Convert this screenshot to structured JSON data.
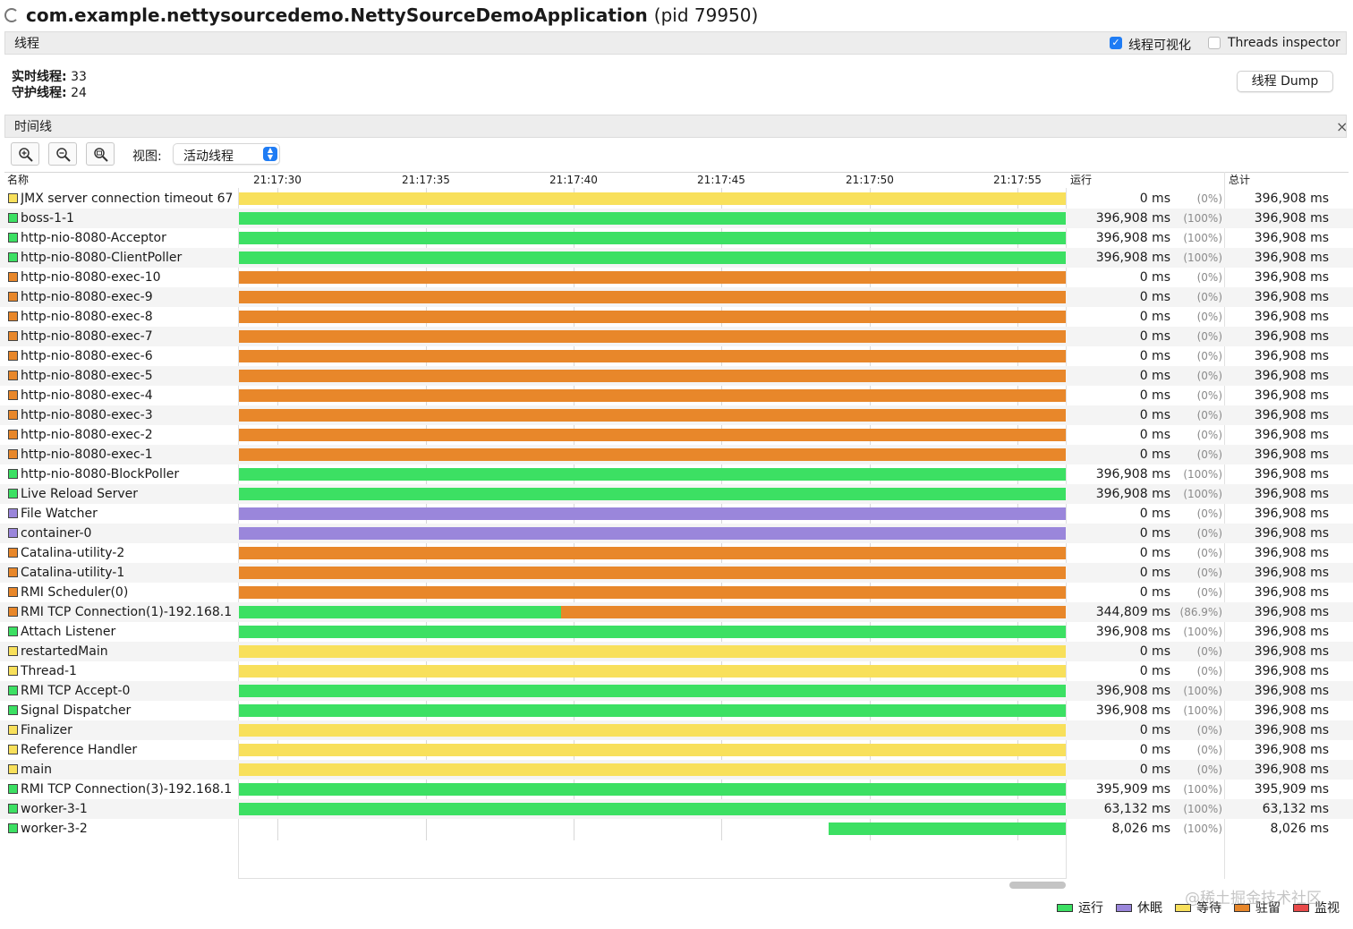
{
  "window": {
    "title": "com.example.nettysourcedemo.NettySourceDemoApplication",
    "pid": "(pid 79950)"
  },
  "threads_section": {
    "title": "线程",
    "viz_checkbox_label": "线程可视化",
    "viz_checked": true,
    "inspector_label": "Threads inspector",
    "inspector_checked": false,
    "live_label": "实时线程:",
    "live_value": "33",
    "daemon_label": "守护线程:",
    "daemon_value": "24",
    "dump_button": "线程 Dump"
  },
  "timeline_section": {
    "title": "时间线",
    "close_glyph": "×",
    "view_label": "视图:",
    "view_value": "活动线程",
    "icons": [
      "zoom-in-icon",
      "zoom-out-icon",
      "zoom-fit-icon",
      "close-icon"
    ]
  },
  "columns": {
    "name": "名称",
    "run": "运行",
    "total": "总计"
  },
  "ticks": [
    "21:17:30",
    "21:17:35",
    "21:17:40",
    "21:17:45",
    "21:17:50",
    "21:17:55"
  ],
  "colors": {
    "running": "#3ce063",
    "sleeping": "#9a86db",
    "waiting": "#f8e05b",
    "parked": "#e8872a",
    "monitor": "#e94a4a"
  },
  "threads": [
    {
      "name": "JMX server connection timeout 67",
      "state": "waiting",
      "run": "0 ms",
      "pct": "(0%)",
      "total": "396,908 ms",
      "segments": [
        {
          "state": "waiting",
          "start": 0,
          "end": 1
        }
      ]
    },
    {
      "name": "boss-1-1",
      "state": "running",
      "run": "396,908 ms",
      "pct": "(100%)",
      "total": "396,908 ms",
      "segments": [
        {
          "state": "running",
          "start": 0,
          "end": 1
        }
      ]
    },
    {
      "name": "http-nio-8080-Acceptor",
      "state": "running",
      "run": "396,908 ms",
      "pct": "(100%)",
      "total": "396,908 ms",
      "segments": [
        {
          "state": "running",
          "start": 0,
          "end": 1
        }
      ]
    },
    {
      "name": "http-nio-8080-ClientPoller",
      "state": "running",
      "run": "396,908 ms",
      "pct": "(100%)",
      "total": "396,908 ms",
      "segments": [
        {
          "state": "running",
          "start": 0,
          "end": 1
        }
      ]
    },
    {
      "name": "http-nio-8080-exec-10",
      "state": "parked",
      "run": "0 ms",
      "pct": "(0%)",
      "total": "396,908 ms",
      "segments": [
        {
          "state": "parked",
          "start": 0,
          "end": 1
        }
      ]
    },
    {
      "name": "http-nio-8080-exec-9",
      "state": "parked",
      "run": "0 ms",
      "pct": "(0%)",
      "total": "396,908 ms",
      "segments": [
        {
          "state": "parked",
          "start": 0,
          "end": 1
        }
      ]
    },
    {
      "name": "http-nio-8080-exec-8",
      "state": "parked",
      "run": "0 ms",
      "pct": "(0%)",
      "total": "396,908 ms",
      "segments": [
        {
          "state": "parked",
          "start": 0,
          "end": 1
        }
      ]
    },
    {
      "name": "http-nio-8080-exec-7",
      "state": "parked",
      "run": "0 ms",
      "pct": "(0%)",
      "total": "396,908 ms",
      "segments": [
        {
          "state": "parked",
          "start": 0,
          "end": 1
        }
      ]
    },
    {
      "name": "http-nio-8080-exec-6",
      "state": "parked",
      "run": "0 ms",
      "pct": "(0%)",
      "total": "396,908 ms",
      "segments": [
        {
          "state": "parked",
          "start": 0,
          "end": 1
        }
      ]
    },
    {
      "name": "http-nio-8080-exec-5",
      "state": "parked",
      "run": "0 ms",
      "pct": "(0%)",
      "total": "396,908 ms",
      "segments": [
        {
          "state": "parked",
          "start": 0,
          "end": 1
        }
      ]
    },
    {
      "name": "http-nio-8080-exec-4",
      "state": "parked",
      "run": "0 ms",
      "pct": "(0%)",
      "total": "396,908 ms",
      "segments": [
        {
          "state": "parked",
          "start": 0,
          "end": 1
        }
      ]
    },
    {
      "name": "http-nio-8080-exec-3",
      "state": "parked",
      "run": "0 ms",
      "pct": "(0%)",
      "total": "396,908 ms",
      "segments": [
        {
          "state": "parked",
          "start": 0,
          "end": 1
        }
      ]
    },
    {
      "name": "http-nio-8080-exec-2",
      "state": "parked",
      "run": "0 ms",
      "pct": "(0%)",
      "total": "396,908 ms",
      "segments": [
        {
          "state": "parked",
          "start": 0,
          "end": 1
        }
      ]
    },
    {
      "name": "http-nio-8080-exec-1",
      "state": "parked",
      "run": "0 ms",
      "pct": "(0%)",
      "total": "396,908 ms",
      "segments": [
        {
          "state": "parked",
          "start": 0,
          "end": 1
        }
      ]
    },
    {
      "name": "http-nio-8080-BlockPoller",
      "state": "running",
      "run": "396,908 ms",
      "pct": "(100%)",
      "total": "396,908 ms",
      "segments": [
        {
          "state": "running",
          "start": 0,
          "end": 1
        }
      ]
    },
    {
      "name": "Live Reload Server",
      "state": "running",
      "run": "396,908 ms",
      "pct": "(100%)",
      "total": "396,908 ms",
      "segments": [
        {
          "state": "running",
          "start": 0,
          "end": 1
        }
      ]
    },
    {
      "name": "File Watcher",
      "state": "sleeping",
      "run": "0 ms",
      "pct": "(0%)",
      "total": "396,908 ms",
      "segments": [
        {
          "state": "sleeping",
          "start": 0,
          "end": 1
        }
      ]
    },
    {
      "name": "container-0",
      "state": "sleeping",
      "run": "0 ms",
      "pct": "(0%)",
      "total": "396,908 ms",
      "segments": [
        {
          "state": "sleeping",
          "start": 0,
          "end": 1
        }
      ]
    },
    {
      "name": "Catalina-utility-2",
      "state": "parked",
      "run": "0 ms",
      "pct": "(0%)",
      "total": "396,908 ms",
      "segments": [
        {
          "state": "parked",
          "start": 0,
          "end": 1
        }
      ]
    },
    {
      "name": "Catalina-utility-1",
      "state": "parked",
      "run": "0 ms",
      "pct": "(0%)",
      "total": "396,908 ms",
      "segments": [
        {
          "state": "parked",
          "start": 0,
          "end": 1
        }
      ]
    },
    {
      "name": "RMI Scheduler(0)",
      "state": "parked",
      "run": "0 ms",
      "pct": "(0%)",
      "total": "396,908 ms",
      "segments": [
        {
          "state": "parked",
          "start": 0,
          "end": 1
        }
      ]
    },
    {
      "name": "RMI TCP Connection(1)-192.168.1",
      "state": "parked",
      "run": "344,809 ms",
      "pct": "(86.9%)",
      "total": "396,908 ms",
      "segments": [
        {
          "state": "running",
          "start": 0,
          "end": 0.39
        },
        {
          "state": "parked",
          "start": 0.39,
          "end": 1
        }
      ]
    },
    {
      "name": "Attach Listener",
      "state": "running",
      "run": "396,908 ms",
      "pct": "(100%)",
      "total": "396,908 ms",
      "segments": [
        {
          "state": "running",
          "start": 0,
          "end": 1
        }
      ]
    },
    {
      "name": "restartedMain",
      "state": "waiting",
      "run": "0 ms",
      "pct": "(0%)",
      "total": "396,908 ms",
      "segments": [
        {
          "state": "waiting",
          "start": 0,
          "end": 1
        }
      ]
    },
    {
      "name": "Thread-1",
      "state": "waiting",
      "run": "0 ms",
      "pct": "(0%)",
      "total": "396,908 ms",
      "segments": [
        {
          "state": "waiting",
          "start": 0,
          "end": 1
        }
      ]
    },
    {
      "name": "RMI TCP Accept-0",
      "state": "running",
      "run": "396,908 ms",
      "pct": "(100%)",
      "total": "396,908 ms",
      "segments": [
        {
          "state": "running",
          "start": 0,
          "end": 1
        }
      ]
    },
    {
      "name": "Signal Dispatcher",
      "state": "running",
      "run": "396,908 ms",
      "pct": "(100%)",
      "total": "396,908 ms",
      "segments": [
        {
          "state": "running",
          "start": 0,
          "end": 1
        }
      ]
    },
    {
      "name": "Finalizer",
      "state": "waiting",
      "run": "0 ms",
      "pct": "(0%)",
      "total": "396,908 ms",
      "segments": [
        {
          "state": "waiting",
          "start": 0,
          "end": 1
        }
      ]
    },
    {
      "name": "Reference Handler",
      "state": "waiting",
      "run": "0 ms",
      "pct": "(0%)",
      "total": "396,908 ms",
      "segments": [
        {
          "state": "waiting",
          "start": 0,
          "end": 1
        }
      ]
    },
    {
      "name": "main",
      "state": "waiting",
      "run": "0 ms",
      "pct": "(0%)",
      "total": "396,908 ms",
      "segments": [
        {
          "state": "waiting",
          "start": 0,
          "end": 1
        }
      ]
    },
    {
      "name": "RMI TCP Connection(3)-192.168.1",
      "state": "running",
      "run": "395,909 ms",
      "pct": "(100%)",
      "total": "395,909 ms",
      "segments": [
        {
          "state": "running",
          "start": 0,
          "end": 1
        }
      ]
    },
    {
      "name": "worker-3-1",
      "state": "running",
      "run": "63,132 ms",
      "pct": "(100%)",
      "total": "63,132 ms",
      "segments": [
        {
          "state": "running",
          "start": 0,
          "end": 1
        }
      ]
    },
    {
      "name": "worker-3-2",
      "state": "running",
      "run": "8,026 ms",
      "pct": "(100%)",
      "total": "8,026 ms",
      "segments": [
        {
          "state": "running",
          "start": 0.713,
          "end": 1
        }
      ]
    }
  ],
  "legend": [
    {
      "label": "运行",
      "state": "running"
    },
    {
      "label": "休眠",
      "state": "sleeping"
    },
    {
      "label": "等待",
      "state": "waiting"
    },
    {
      "label": "驻留",
      "state": "parked"
    },
    {
      "label": "监视",
      "state": "monitor"
    }
  ],
  "watermark": "@稀土掘金技术社区"
}
